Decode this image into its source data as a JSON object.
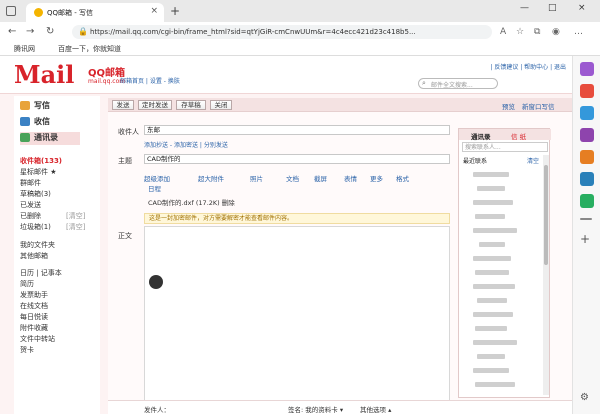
{
  "browser": {
    "tab_title": "QQ邮箱 - 写信",
    "tab_close": "×",
    "new_tab": "+",
    "url": "https://mail.qq.com/cgi-bin/frame_html?sid=qtYjGiR-cmCnwUUm&r=4c4ecc421d23c418b5...",
    "bookmarks": [
      "腾讯网",
      "百度一下，你就知道"
    ],
    "window_controls": [
      "—",
      "□",
      "×"
    ]
  },
  "header": {
    "logo_letters": "Mail",
    "logo_cn": "QQ邮箱",
    "logo_sub": "mail.qq.com",
    "user_links": "邮箱首页 | 设置 - 换肤",
    "top_links": "| 反馈建议 | 帮助中心 | 退出",
    "search_placeholder": "邮件全文搜索..."
  },
  "nav": {
    "write": "写信",
    "inbox": "收信",
    "contacts": "通讯录",
    "folders": [
      {
        "label": "收件箱(133)",
        "active": true
      },
      {
        "label": "星标邮件 ★"
      },
      {
        "label": "群邮件"
      },
      {
        "label": "草稿箱(3)"
      },
      {
        "label": "已发送"
      },
      {
        "label": "已删除",
        "extra": "[清空]"
      },
      {
        "label": "垃圾箱(1)",
        "extra": "[清空]"
      }
    ],
    "folders2": [
      {
        "label": "我的文件夹"
      },
      {
        "label": "其他邮箱"
      }
    ],
    "folders3": [
      {
        "label": "日历 | 记事本"
      },
      {
        "label": "简历"
      },
      {
        "label": "发票助手"
      },
      {
        "label": "在线文档"
      },
      {
        "label": "每日悦读"
      },
      {
        "label": "附件收藏"
      },
      {
        "label": "文件中转站"
      },
      {
        "label": "贺卡"
      }
    ]
  },
  "compose": {
    "toolbar": [
      "发送",
      "定时发送",
      "存草稿",
      "关闭"
    ],
    "toolbar_right": [
      "预览",
      "新窗口写信"
    ],
    "to_label": "收件人",
    "to_value": "东邮",
    "add_links": "添加抄送 - 添加密送 | 分别发送",
    "subject_label": "主题",
    "subject_value": "CAD制作的",
    "attach_tools": [
      "超级添加",
      "超大附件",
      "照片",
      "文档",
      "截屏",
      "表情",
      "更多",
      "格式"
    ],
    "schedule": "日程",
    "attachment": "CAD制作的.dxf (17.2K) 删除",
    "warning": "这是一封加密邮件，对方需要解密才能查看邮件内容。",
    "body_label": "正文",
    "bottom_sender_label": "发件人：",
    "bottom_sig": "签名: 我的资料卡 ▾",
    "bottom_other": "其他选项 ▴"
  },
  "contacts_panel": {
    "tab_contacts": "通讯录",
    "tab_other": "信 纸",
    "search_ph": "搜索联系人...",
    "recent": "最近联系",
    "clear": "清空"
  }
}
